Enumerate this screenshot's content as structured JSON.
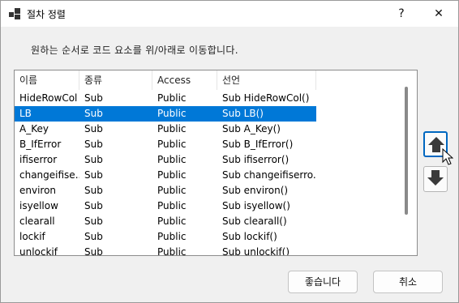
{
  "window": {
    "title": "절차 정렬",
    "help_label": "?",
    "close_label": "✕"
  },
  "instruction": "원하는 순서로 코드 요소를 위/아래로 이동합니다.",
  "table": {
    "columns": [
      "이름",
      "종류",
      "Access",
      "선언"
    ],
    "rows": [
      {
        "name": "HideRowCol",
        "kind": "Sub",
        "access": "Public",
        "decl": "Sub HideRowCol()"
      },
      {
        "name": "LB",
        "kind": "Sub",
        "access": "Public",
        "decl": "Sub LB()"
      },
      {
        "name": "A_Key",
        "kind": "Sub",
        "access": "Public",
        "decl": "Sub A_Key()"
      },
      {
        "name": "B_IfError",
        "kind": "Sub",
        "access": "Public",
        "decl": "Sub B_IfError()"
      },
      {
        "name": "ifiserror",
        "kind": "Sub",
        "access": "Public",
        "decl": "Sub ifiserror()"
      },
      {
        "name": "changeifise...",
        "kind": "Sub",
        "access": "Public",
        "decl": "Sub changeifiserro..."
      },
      {
        "name": "environ",
        "kind": "Sub",
        "access": "Public",
        "decl": "Sub environ()"
      },
      {
        "name": "isyellow",
        "kind": "Sub",
        "access": "Public",
        "decl": "Sub isyellow()"
      },
      {
        "name": "clearall",
        "kind": "Sub",
        "access": "Public",
        "decl": "Sub clearall()"
      },
      {
        "name": "lockif",
        "kind": "Sub",
        "access": "Public",
        "decl": "Sub lockif()"
      },
      {
        "name": "unlockif",
        "kind": "Sub",
        "access": "Public",
        "decl": "Sub unlockif()"
      }
    ],
    "selected_index": 1
  },
  "buttons": {
    "move_up_icon": "arrow-up-icon",
    "move_down_icon": "arrow-down-icon",
    "ok_label": "좋습니다",
    "cancel_label": "취소"
  },
  "colors": {
    "selection": "#0078d7",
    "focus_border": "#0067c0"
  }
}
